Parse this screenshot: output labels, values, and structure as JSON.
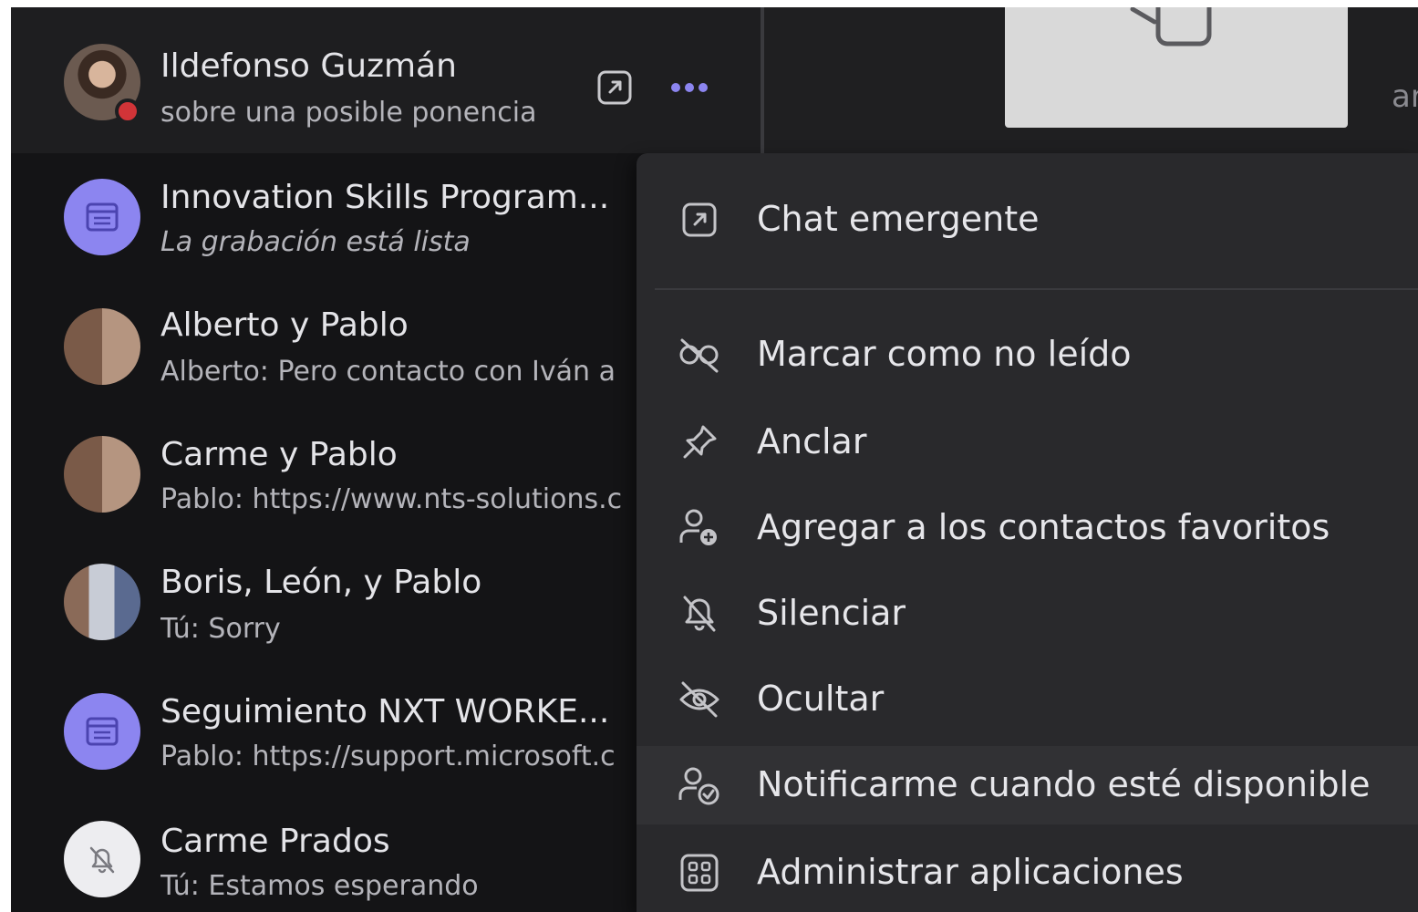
{
  "chat_list": {
    "selected": {
      "name": "Ildefonso Guzmán",
      "preview": "sobre una posible ponencia",
      "presence": "busy",
      "presence_color": "#d13438"
    },
    "items": [
      {
        "name": "Innovation Skills Program...",
        "preview": "La grabación está lista",
        "avatar": "meeting-icon"
      },
      {
        "name": "Alberto y Pablo",
        "preview": "Alberto: Pero contacto con Iván a",
        "avatar": "group-photo"
      },
      {
        "name": "Carme y Pablo",
        "preview": "Pablo: https://www.nts-solutions.c",
        "avatar": "group-photo"
      },
      {
        "name": "Boris, León, y Pablo",
        "preview": "Tú: Sorry",
        "avatar": "group-photo"
      },
      {
        "name": "Seguimiento NXT WORKE...",
        "preview": "Pablo: https://support.microsoft.c",
        "avatar": "meeting-icon"
      },
      {
        "name": "Carme Prados",
        "preview": "Tú: Estamos esperando",
        "avatar": "muted-bell-icon"
      }
    ]
  },
  "right_pane": {
    "side_text": "ar"
  },
  "context_menu": {
    "items": [
      {
        "label": "Chat emergente",
        "icon": "popout-icon"
      },
      {
        "label": "Marcar como no leído",
        "icon": "mark-unread-icon"
      },
      {
        "label": "Anclar",
        "icon": "pin-icon"
      },
      {
        "label": "Agregar a los contactos favoritos",
        "icon": "add-favorite-contact-icon"
      },
      {
        "label": "Silenciar",
        "icon": "mute-icon"
      },
      {
        "label": "Ocultar",
        "icon": "hide-icon"
      },
      {
        "label": "Notificarme cuando esté disponible",
        "icon": "notify-available-icon"
      },
      {
        "label": "Administrar aplicaciones",
        "icon": "manage-apps-icon"
      }
    ],
    "hovered_item": "Notificarme cuando esté disponible"
  },
  "colors": {
    "accent_meeting_avatar": "#8c85f0",
    "more_options": "#8c85f0",
    "menu_bg": "#29292c",
    "list_bg": "#141416"
  }
}
